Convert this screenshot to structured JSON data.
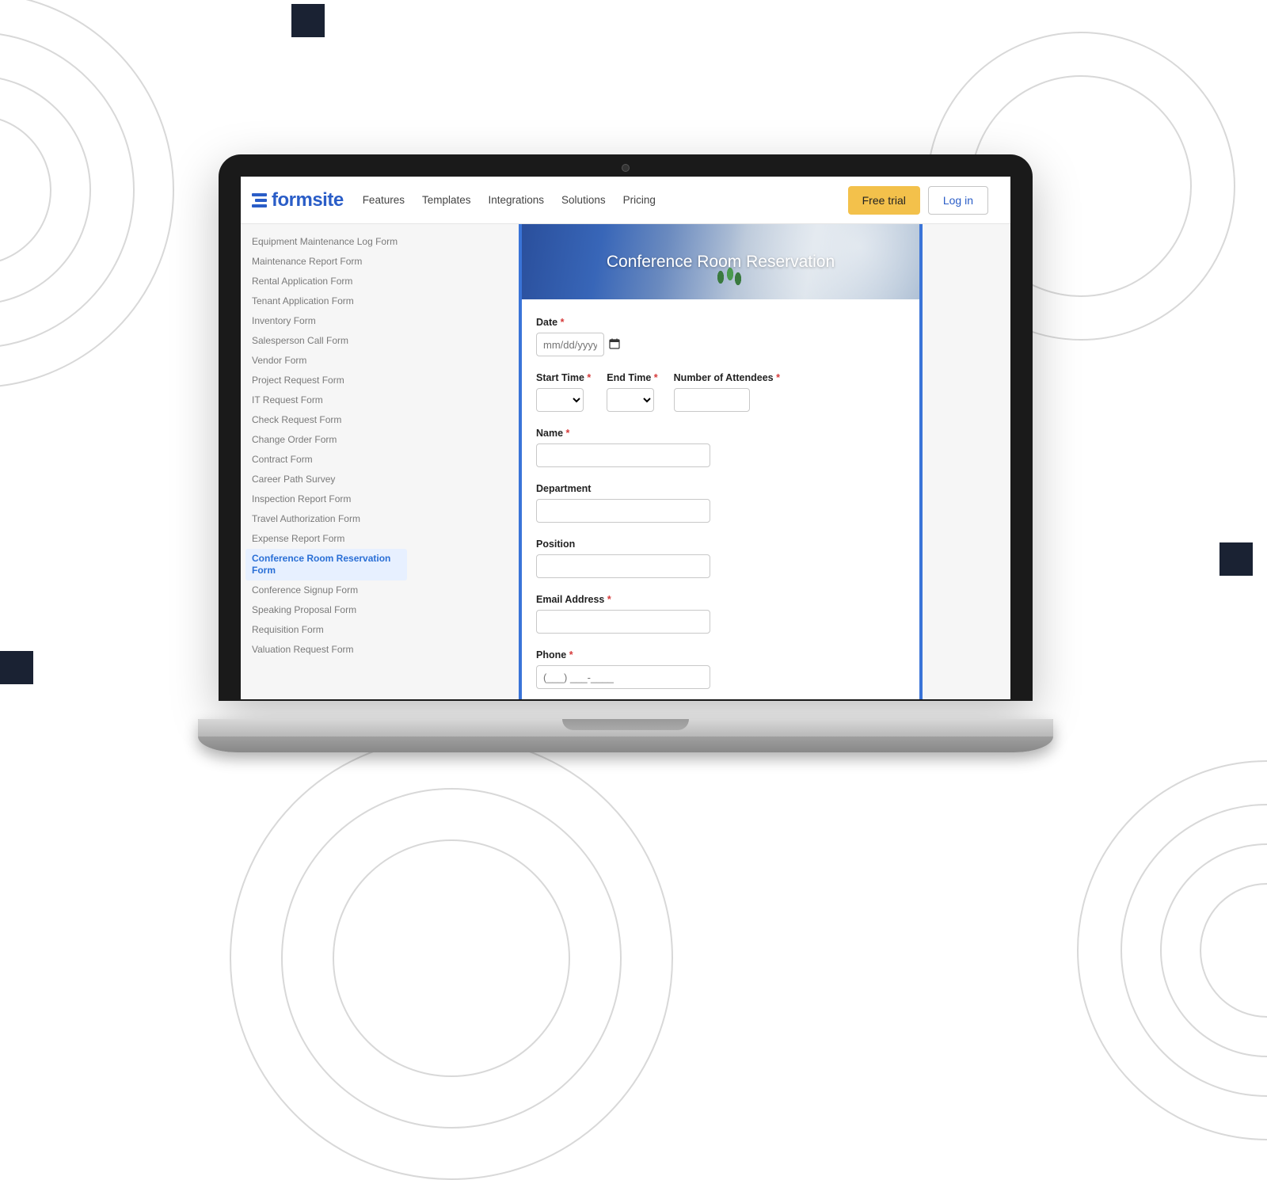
{
  "brand": "formsite",
  "nav": {
    "features": "Features",
    "templates": "Templates",
    "integrations": "Integrations",
    "solutions": "Solutions",
    "pricing": "Pricing"
  },
  "actions": {
    "trial": "Free trial",
    "login": "Log in"
  },
  "sidebar": {
    "items": [
      {
        "label": "Equipment Maintenance Log Form",
        "active": false
      },
      {
        "label": "Maintenance Report Form",
        "active": false
      },
      {
        "label": "Rental Application Form",
        "active": false
      },
      {
        "label": "Tenant Application Form",
        "active": false
      },
      {
        "label": "Inventory Form",
        "active": false
      },
      {
        "label": "Salesperson Call Form",
        "active": false
      },
      {
        "label": "Vendor Form",
        "active": false
      },
      {
        "label": "Project Request Form",
        "active": false
      },
      {
        "label": "IT Request Form",
        "active": false
      },
      {
        "label": "Check Request Form",
        "active": false
      },
      {
        "label": "Change Order Form",
        "active": false
      },
      {
        "label": "Contract Form",
        "active": false
      },
      {
        "label": "Career Path Survey",
        "active": false
      },
      {
        "label": "Inspection Report Form",
        "active": false
      },
      {
        "label": "Travel Authorization Form",
        "active": false
      },
      {
        "label": "Expense Report Form",
        "active": false
      },
      {
        "label": "Conference Room Reservation Form",
        "active": true
      },
      {
        "label": "Conference Signup Form",
        "active": false
      },
      {
        "label": "Speaking Proposal Form",
        "active": false
      },
      {
        "label": "Requisition Form",
        "active": false
      },
      {
        "label": "Valuation Request Form",
        "active": false
      }
    ]
  },
  "form": {
    "title": "Conference Room Reservation",
    "fields": {
      "date": {
        "label": "Date",
        "required": true,
        "placeholder": "mm/dd/yyyy"
      },
      "start": {
        "label": "Start Time",
        "required": true
      },
      "end": {
        "label": "End Time",
        "required": true
      },
      "attendees": {
        "label": "Number of Attendees",
        "required": true
      },
      "name": {
        "label": "Name",
        "required": true
      },
      "department": {
        "label": "Department",
        "required": false
      },
      "position": {
        "label": "Position",
        "required": false
      },
      "email": {
        "label": "Email Address",
        "required": true
      },
      "phone": {
        "label": "Phone",
        "required": true,
        "placeholder": "(___) ___-____"
      }
    },
    "asterisk": "*"
  }
}
